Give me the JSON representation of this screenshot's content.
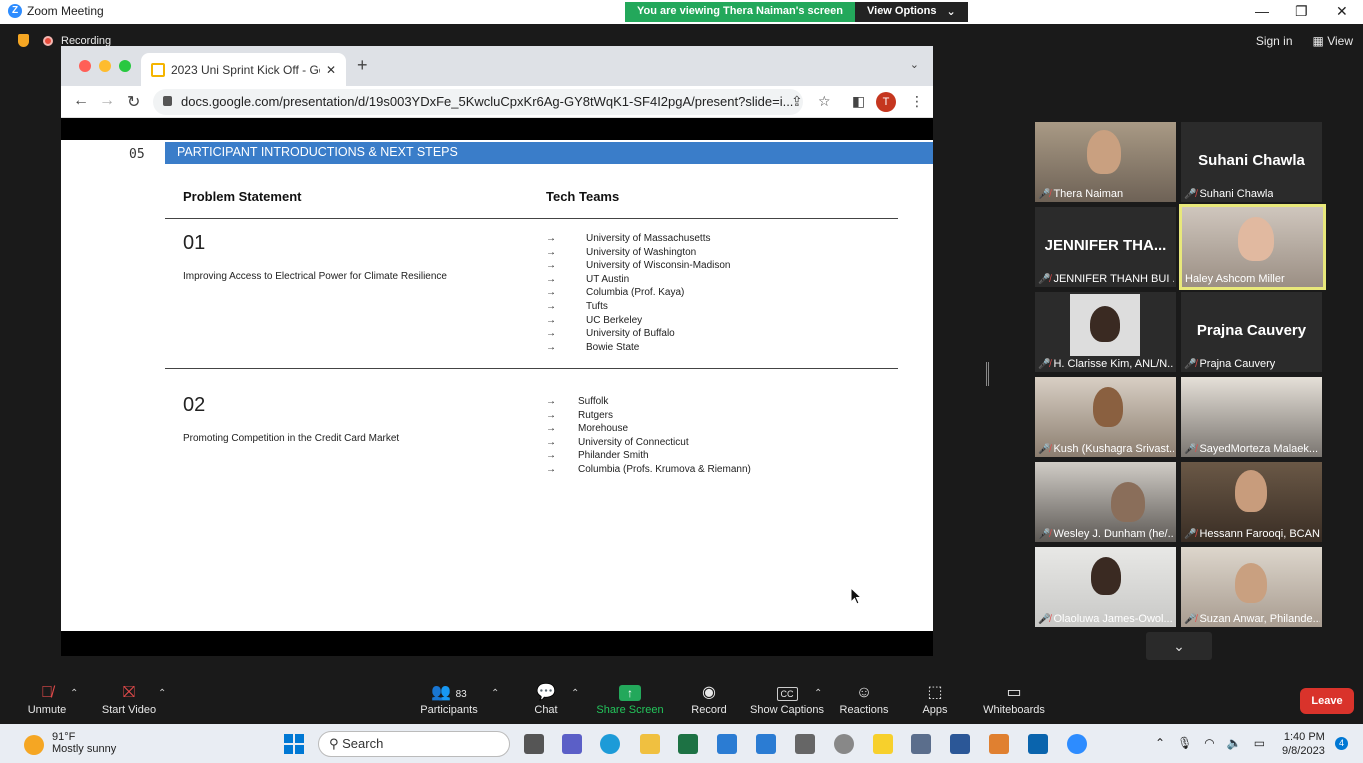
{
  "window": {
    "title": "Zoom Meeting",
    "banner_text": "You are viewing Thera Naiman's screen",
    "view_options": "View Options"
  },
  "meeting": {
    "recording_label": "Recording",
    "sign_in": "Sign in",
    "view": "View"
  },
  "browser": {
    "tab_title": "2023 Uni Sprint Kick Off - Goo",
    "url": "docs.google.com/presentation/d/19s003YDxFe_5KwcluCpxKr6Ag-GY8tWqK1-SF4I2pgA/present?slide=i...",
    "profile_initial": "T"
  },
  "slide": {
    "section_number": "05",
    "section_title": "PARTICIPANT INTRODUCTIONS & NEXT STEPS",
    "col_problem": "Problem Statement",
    "col_teams": "Tech Teams",
    "arrow": "→",
    "problems": [
      {
        "number": "01",
        "text": "Improving Access to Electrical Power for Climate Resilience",
        "teams": [
          "University of Massachusetts",
          "University of Washington",
          "University of Wisconsin-Madison",
          "UT Austin",
          "Columbia (Prof. Kaya)",
          "Tufts",
          "UC Berkeley",
          "University of Buffalo",
          "Bowie State"
        ]
      },
      {
        "number": "02",
        "text": "Promoting Competition in the Credit Card Market",
        "teams": [
          "Suffolk",
          "Rutgers",
          "Morehouse",
          "University of Connecticut",
          "Philander Smith",
          "Columbia (Profs. Krumova & Riemann)"
        ]
      }
    ]
  },
  "gallery": [
    {
      "name": "Thera Naiman",
      "big": "",
      "video": true
    },
    {
      "name": "Suhani Chawla",
      "big": "Suhani Chawla",
      "video": false
    },
    {
      "name": "JENNIFER THANH BUI ...",
      "big": "JENNIFER THA...",
      "video": false
    },
    {
      "name": "Haley Ashcom Miller",
      "big": "",
      "video": true,
      "active": true
    },
    {
      "name": "H. Clarisse Kim, ANL/N...",
      "big": "",
      "video": false,
      "photo": true
    },
    {
      "name": "Prajna Cauvery",
      "big": "Prajna Cauvery",
      "video": false
    },
    {
      "name": "Kush (Kushagra Srivast...",
      "big": "",
      "video": true
    },
    {
      "name": "SayedMorteza Malaek...",
      "big": "",
      "video": true
    },
    {
      "name": "Wesley J. Dunham (he/...",
      "big": "",
      "video": true
    },
    {
      "name": "Hessann Farooqi, BCAN",
      "big": "",
      "video": true
    },
    {
      "name": "Olaoluwa James-Owol...",
      "big": "",
      "video": true
    },
    {
      "name": "Suzan Anwar, Philande...",
      "big": "",
      "video": true
    }
  ],
  "toolbar": {
    "unmute": "Unmute",
    "start_video": "Start Video",
    "participants": "Participants",
    "participants_count": "83",
    "chat": "Chat",
    "share_screen": "Share Screen",
    "record": "Record",
    "show_captions": "Show Captions",
    "reactions": "Reactions",
    "apps": "Apps",
    "whiteboards": "Whiteboards",
    "leave": "Leave",
    "cc": "CC"
  },
  "taskbar": {
    "temp": "91°F",
    "weather": "Mostly sunny",
    "search": "Search",
    "time": "1:40 PM",
    "date": "9/8/2023",
    "notifications": "4"
  }
}
